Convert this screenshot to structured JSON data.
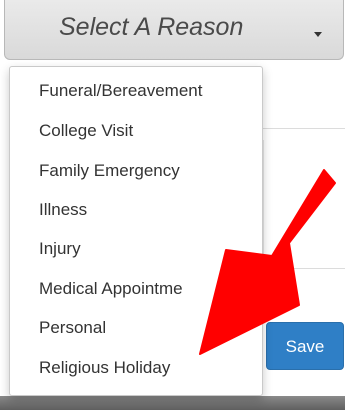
{
  "select": {
    "label": "Select A Reason",
    "caret_icon": "caret-down-icon"
  },
  "menu": {
    "items": [
      "Funeral/Bereavement",
      "College Visit",
      "Family Emergency",
      "Illness",
      "Injury",
      "Medical Appointme",
      "Personal",
      "Religious Holiday"
    ]
  },
  "form": {
    "save_label": "Save"
  },
  "annotation": {
    "arrow_icon": "red-arrow-icon",
    "arrow_color": "#ff0000"
  },
  "colors": {
    "save_button": "#2f7fc6",
    "menu_text": "#333333"
  }
}
